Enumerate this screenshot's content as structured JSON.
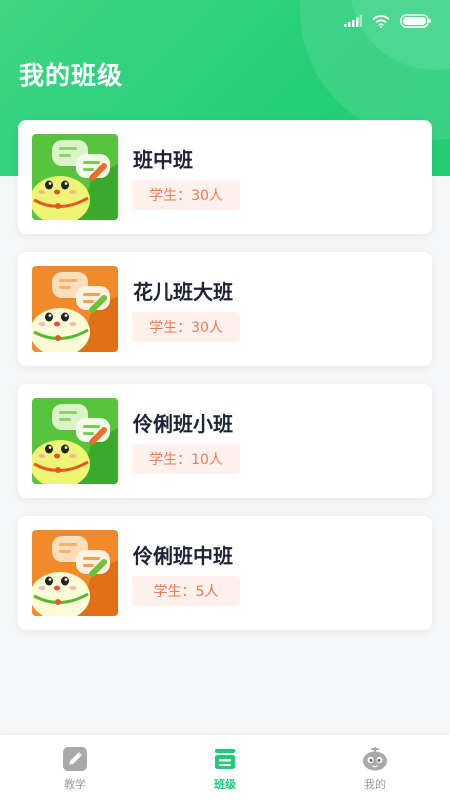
{
  "header": {
    "title": "我的班级",
    "colors": {
      "start": "#3ed683",
      "end": "#22cd76"
    }
  },
  "status_bar": {
    "icons": [
      "signal-icon",
      "wifi-icon",
      "battery-icon"
    ]
  },
  "classes": [
    {
      "name": "班中班",
      "students": "学生：30人",
      "thumb_theme": "green"
    },
    {
      "name": "花儿班大班",
      "students": "学生：30人",
      "thumb_theme": "orange"
    },
    {
      "name": "伶俐班小班",
      "students": "学生：10人",
      "thumb_theme": "green"
    },
    {
      "name": "伶俐班中班",
      "students": "学生：5人",
      "thumb_theme": "orange"
    }
  ],
  "tabbar": {
    "items": [
      {
        "label": "教学",
        "icon": "pencil-icon",
        "active": false
      },
      {
        "label": "班级",
        "icon": "class-icon",
        "active": true
      },
      {
        "label": "我的",
        "icon": "profile-icon",
        "active": false
      }
    ],
    "active_color": "#23c97a",
    "inactive_color": "#9a9a9a"
  }
}
